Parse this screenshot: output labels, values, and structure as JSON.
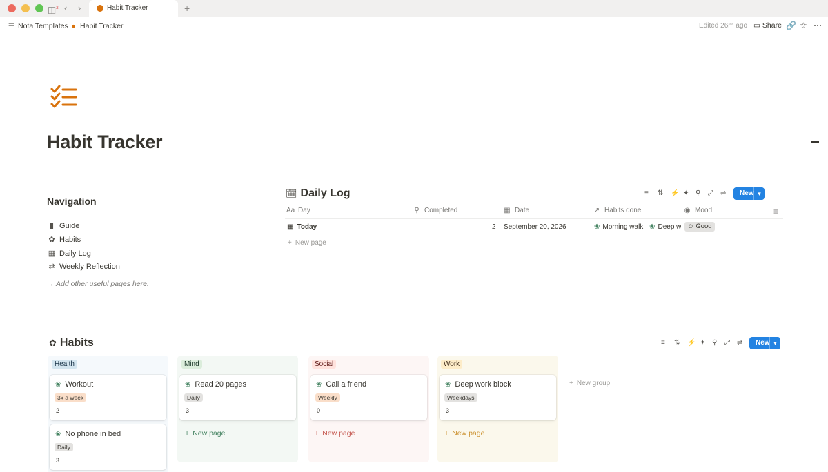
{
  "window": {
    "tab_title": "Habit Tracker",
    "badge_count": "2"
  },
  "topbar": {
    "breadcrumb": [
      "Nota Templates",
      "Habit Tracker"
    ],
    "edited": "Edited 26m ago",
    "share_label": "Share"
  },
  "page": {
    "title": "Habit Tracker",
    "icon": "checklist-icon",
    "accent_color": "#d9730d"
  },
  "navigation": {
    "heading": "Navigation",
    "items": [
      {
        "label": "Guide",
        "icon": "document-icon"
      },
      {
        "label": "Habits",
        "icon": "leaves-icon"
      },
      {
        "label": "Daily Log",
        "icon": "calendar-icon"
      },
      {
        "label": "Weekly Reflection",
        "icon": "calendar-cycle-icon"
      }
    ],
    "hint": "→ Add other useful pages here."
  },
  "daily_log": {
    "title": "Daily Log",
    "new_label": "New",
    "columns": [
      "Day",
      "Completed",
      "Date",
      "Habits done",
      "Mood"
    ],
    "rows": [
      {
        "day": "Today",
        "completed": "2",
        "date": "September 20, 2026",
        "habits_done": [
          "Morning walk",
          "Deep w"
        ],
        "mood": "Good"
      }
    ],
    "new_page_label": "New page"
  },
  "habits_board": {
    "title": "Habits",
    "new_label": "New",
    "new_group_label": "New group",
    "groups": [
      {
        "name": "Health",
        "color": "#d3e5ef",
        "cards": [
          {
            "title": "Workout",
            "frequency": "3x a week",
            "freq_color": "#fadec9",
            "count": "2"
          },
          {
            "title": "No phone in bed",
            "frequency": "Daily",
            "freq_color": "#e3e2e0",
            "count": "3"
          }
        ]
      },
      {
        "name": "Mind",
        "color": "#dbeddb",
        "cards": [
          {
            "title": "Read 20 pages",
            "frequency": "Daily",
            "freq_color": "#e3e2e0",
            "count": "3"
          }
        ],
        "new_page_label": "New page"
      },
      {
        "name": "Social",
        "color": "#ffe2dd",
        "cards": [
          {
            "title": "Call a friend",
            "frequency": "Weekly",
            "freq_color": "#fadec9",
            "count": "0"
          }
        ],
        "new_page_label": "New page"
      },
      {
        "name": "Work",
        "color": "#fdecc8",
        "cards": [
          {
            "title": "Deep work block",
            "frequency": "Weekdays",
            "freq_color": "#e3e2e0",
            "count": "3"
          }
        ],
        "new_page_label": "New page"
      }
    ]
  }
}
